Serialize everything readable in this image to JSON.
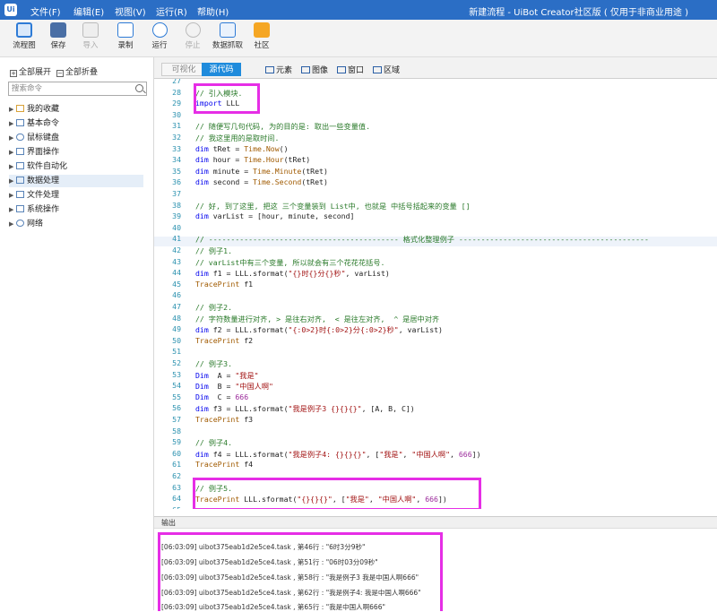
{
  "window": {
    "menus": [
      "文件(F)",
      "编辑(E)",
      "视图(V)",
      "运行(R)",
      "帮助(H)"
    ],
    "title": "新建流程 - UiBot Creator社区版 ( 仅用于非商业用途 )"
  },
  "toolbar": {
    "items": [
      {
        "label": "流程图",
        "icon": "flowchart-icon"
      },
      {
        "label": "保存",
        "icon": "save-icon"
      },
      {
        "label": "导入",
        "icon": "import-icon",
        "disabled": true
      },
      {
        "label": "录制",
        "icon": "record-icon"
      },
      {
        "label": "运行",
        "icon": "play-icon"
      },
      {
        "label": "停止",
        "icon": "stop-icon",
        "disabled": true
      },
      {
        "label": "数据抓取",
        "icon": "data-scrape-icon"
      },
      {
        "label": "社区",
        "icon": "community-icon"
      }
    ]
  },
  "sidebar": {
    "expand_all": "全部展开",
    "collapse_all": "全部折叠",
    "search_placeholder": "搜索命令",
    "items": [
      {
        "label": "我的收藏"
      },
      {
        "label": "基本命令"
      },
      {
        "label": "鼠标键盘"
      },
      {
        "label": "界面操作"
      },
      {
        "label": "软件自动化"
      },
      {
        "label": "数据处理"
      },
      {
        "label": "文件处理"
      },
      {
        "label": "系统操作"
      },
      {
        "label": "网络"
      }
    ],
    "selected": "数据处理"
  },
  "editor": {
    "tabs": [
      "可视化",
      "源代码"
    ],
    "active_tab": "源代码",
    "element_tools": [
      "元素",
      "图像",
      "窗口",
      "区域"
    ],
    "lines": [
      {
        "n": "27",
        "t": ""
      },
      {
        "n": "28",
        "t": "// 引入模块."
      },
      {
        "n": "29",
        "t": "import LLL"
      },
      {
        "n": "30",
        "t": ""
      },
      {
        "n": "31",
        "t": "// 随便写几句代码, 为的目的是: 取出一些变量值."
      },
      {
        "n": "32",
        "t": "// 我这里用的是取时间."
      },
      {
        "n": "33",
        "t": "dim tRet = Time.Now()"
      },
      {
        "n": "34",
        "t": "dim hour = Time.Hour(tRet)"
      },
      {
        "n": "35",
        "t": "dim minute = Time.Minute(tRet)"
      },
      {
        "n": "36",
        "t": "dim second = Time.Second(tRet)"
      },
      {
        "n": "37",
        "t": ""
      },
      {
        "n": "38",
        "t": "// 好, 到了这里, 把这 三个变量装到 List中, 也就是 中括号括起来的变量 []"
      },
      {
        "n": "39",
        "t": "dim varList = [hour, minute, second]"
      },
      {
        "n": "40",
        "t": ""
      },
      {
        "n": "41",
        "t": "// ------------------------------------------- 格式化整理例子 -------------------------------------------"
      },
      {
        "n": "42",
        "t": "// 例子1."
      },
      {
        "n": "43",
        "t": "// varList中有三个变量, 所以就会有三个花花花括号."
      },
      {
        "n": "44",
        "t": "dim f1 = LLL.sformat(\"{}时{}分{}秒\", varList)"
      },
      {
        "n": "45",
        "t": "TracePrint f1"
      },
      {
        "n": "46",
        "t": ""
      },
      {
        "n": "47",
        "t": "// 例子2."
      },
      {
        "n": "48",
        "t": "// 字符数量进行对齐, > 是往右对齐,  < 是往左对齐,  ^ 是居中对齐"
      },
      {
        "n": "49",
        "t": "dim f2 = LLL.sformat(\"{:0>2}时{:0>2}分{:0>2}秒\", varList)"
      },
      {
        "n": "50",
        "t": "TracePrint f2"
      },
      {
        "n": "51",
        "t": ""
      },
      {
        "n": "52",
        "t": "// 例子3."
      },
      {
        "n": "53",
        "t": "Dim  A = \"我是\""
      },
      {
        "n": "54",
        "t": "Dim  B = \"中国人啊\""
      },
      {
        "n": "55",
        "t": "Dim  C = 666"
      },
      {
        "n": "56",
        "t": "dim f3 = LLL.sformat(\"我是例子3 {}{}{}\", [A, B, C])"
      },
      {
        "n": "57",
        "t": "TracePrint f3"
      },
      {
        "n": "58",
        "t": ""
      },
      {
        "n": "59",
        "t": "// 例子4."
      },
      {
        "n": "60",
        "t": "dim f4 = LLL.sformat(\"我是例子4: {}{}{}\", [\"我是\", \"中国人啊\", 666])"
      },
      {
        "n": "61",
        "t": "TracePrint f4"
      },
      {
        "n": "62",
        "t": ""
      },
      {
        "n": "63",
        "t": "// 例子5."
      },
      {
        "n": "64",
        "t": "TracePrint LLL.sformat(\"{}{}{}\", [\"我是\", \"中国人啊\", 666])"
      },
      {
        "n": "65",
        "t": ""
      }
    ]
  },
  "output": {
    "title": "输出",
    "lines": [
      "[06:03:09] uibot375eab1d2e5ce4.task , 第46行 : \"6时3分9秒\"",
      "[06:03:09] uibot375eab1d2e5ce4.task , 第51行 : \"06时03分09秒\"",
      "[06:03:09] uibot375eab1d2e5ce4.task , 第58行 : \"我是例子3 我是中国人啊666\"",
      "[06:03:09] uibot375eab1d2e5ce4.task , 第62行 : \"我是例子4: 我是中国人啊666\"",
      "[06:03:09] uibot375eab1d2e5ce4.task , 第65行 : \"我是中国人啊666\""
    ]
  },
  "colors": {
    "titlebar": "#2b6ec5",
    "active_tab": "#1f8bdc",
    "highlight_box": "#e62ee6",
    "comment": "#2a7a2a",
    "keyword": "#0000ee",
    "string": "#a31515"
  }
}
